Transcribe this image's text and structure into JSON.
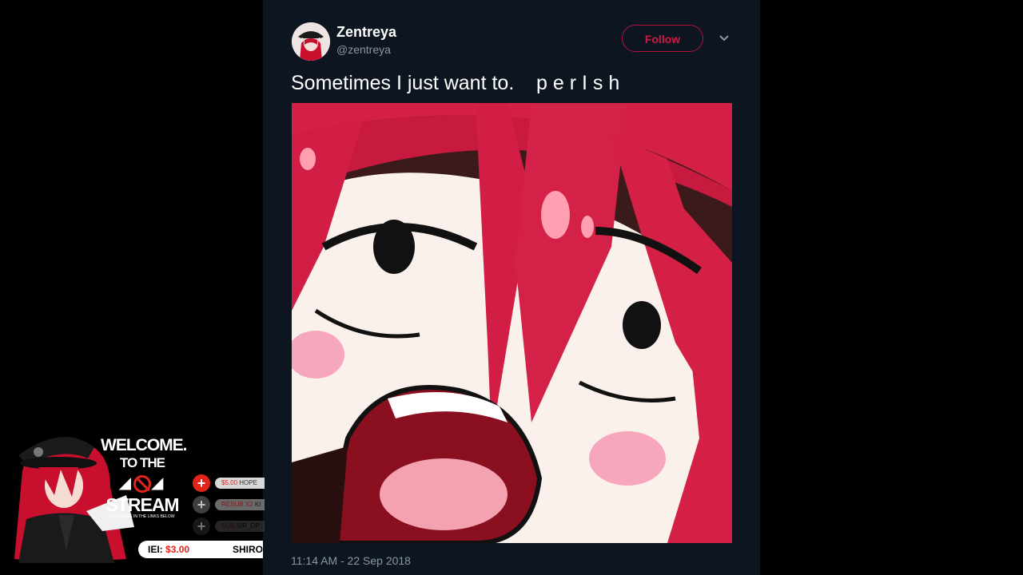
{
  "tweet": {
    "display_name": "Zentreya",
    "handle": "@zentreya",
    "follow_label": "Follow",
    "text": "Sometimes I just want to.    p e r I s h",
    "timestamp": "11:14 AM - 22 Sep 2018",
    "caret_icon": "chevron-down-icon",
    "colors": {
      "background": "#0d1520",
      "accent": "#d01845",
      "muted": "#8899a6"
    }
  },
  "overlay": {
    "welcome_line1": "WELCOME.",
    "welcome_line2": "TO THE",
    "welcome_line3": "STREAM",
    "welcome_small": "FIND MORE IN THE LINKS BELOW",
    "feed": [
      {
        "amount": "$5.00",
        "name": "HOPE",
        "color": "#e2231a"
      },
      {
        "amount": "RESUB X2",
        "name": "KI",
        "color": "#b02020"
      },
      {
        "amount": "SUB",
        "name": "SIR_DP",
        "color": "#601010"
      }
    ],
    "goal_label": "IEI:",
    "goal_amount": "$3.00",
    "goal_name": "SHIRO"
  }
}
